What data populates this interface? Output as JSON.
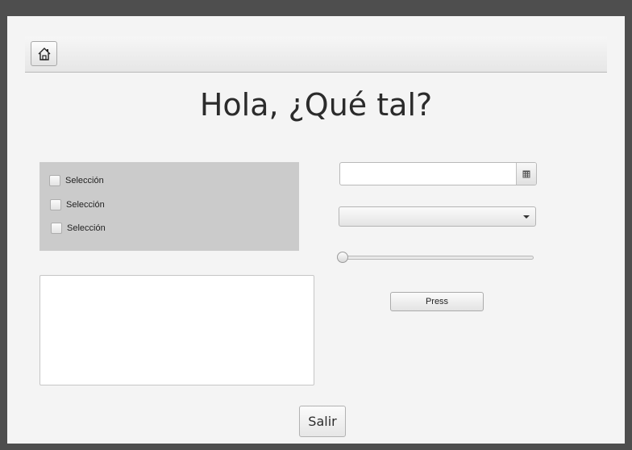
{
  "title": "Hola, ¿Qué tal?",
  "toolbar": {
    "home_icon": "home-icon"
  },
  "checkboxes": [
    {
      "label": "Selección",
      "checked": false
    },
    {
      "label": "Selección",
      "checked": false
    },
    {
      "label": "Selección",
      "checked": false
    }
  ],
  "textarea": {
    "value": ""
  },
  "date_picker": {
    "value": "",
    "icon": "calendar-icon"
  },
  "combo_box": {
    "selected": "",
    "icon": "chevron-down-icon"
  },
  "slider": {
    "value": 0
  },
  "buttons": {
    "press_label": "Press",
    "exit_label": "Salir"
  }
}
